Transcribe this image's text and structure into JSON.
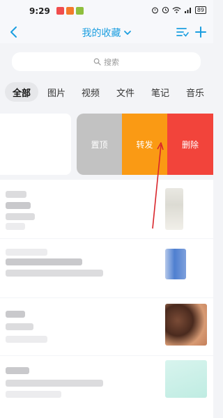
{
  "status_bar": {
    "time": "9:29",
    "battery": "89"
  },
  "header": {
    "title": "我的收藏"
  },
  "search": {
    "placeholder": "搜索"
  },
  "tabs": [
    {
      "label": "全部",
      "active": true
    },
    {
      "label": "图片",
      "active": false
    },
    {
      "label": "视频",
      "active": false
    },
    {
      "label": "文件",
      "active": false
    },
    {
      "label": "笔记",
      "active": false
    },
    {
      "label": "音乐",
      "active": false
    }
  ],
  "swipe_actions": {
    "pin": "置顶",
    "forward": "转发",
    "delete": "删除"
  },
  "colors": {
    "accent": "#1b9ee0",
    "pin": "#c2c2c2",
    "forward": "#fa9a14",
    "delete": "#f2443b",
    "annotation": "#d9252b"
  },
  "icons": {
    "back": "chevron-left-icon",
    "title_dropdown": "chevron-down-icon",
    "sort": "sort-list-icon",
    "add": "plus-icon",
    "search": "search-icon"
  }
}
